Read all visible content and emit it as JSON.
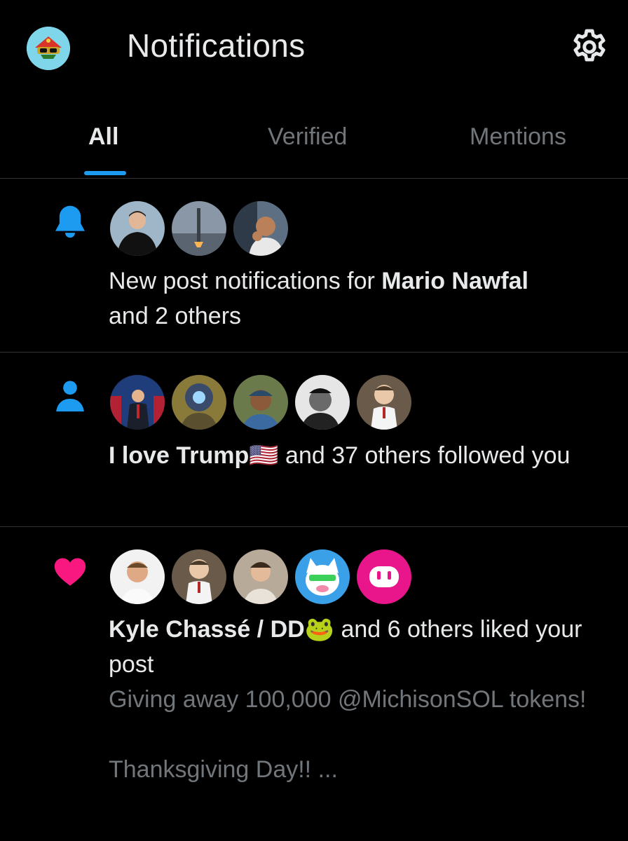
{
  "header": {
    "title": "Notifications",
    "profile_icon": "profile-avatar-icon",
    "settings_icon": "gear-icon"
  },
  "tabs": [
    {
      "label": "All",
      "active": true
    },
    {
      "label": "Verified",
      "active": false
    },
    {
      "label": "Mentions",
      "active": false
    }
  ],
  "colors": {
    "accent": "#1d9bf0",
    "like": "#f91880",
    "text": "#e7e9ea",
    "muted": "#71767b",
    "divider": "#2f3336"
  },
  "notifications": [
    {
      "icon": "bell-icon",
      "text_prefix": "New post notifications for ",
      "name": "Mario Nawfal",
      "text_suffix": "and 2 others"
    },
    {
      "icon": "person-icon",
      "name": "I love Trump🇺🇸",
      "text_suffix": " and 37 others followed you"
    },
    {
      "icon": "heart-icon",
      "name": "Kyle Chassé / DD🐸",
      "text_suffix": " and 6 others liked your post",
      "preview_line1": "Giving away 100,000 @MichisonSOL tokens!",
      "preview_line2": "Thanksgiving Day!!  ..."
    }
  ]
}
